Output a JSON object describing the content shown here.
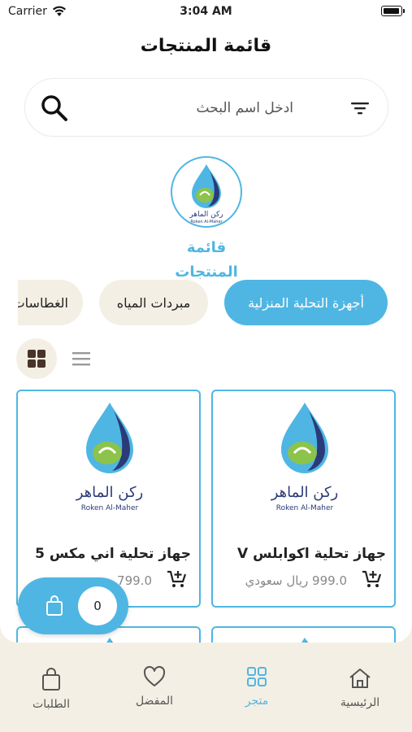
{
  "status_bar": {
    "carrier": "Carrier",
    "time": "3:04 AM"
  },
  "header": {
    "title": "قائمة المنتجات"
  },
  "search": {
    "placeholder": "ادخل اسم البحث",
    "value": ""
  },
  "brand": {
    "logo_text_ar": "ركن الماهر",
    "logo_text_en": "Roken Al-Maher",
    "caption": "قائمة المنتجات"
  },
  "categories": [
    {
      "label": "أجهزة التحلية المنزلية",
      "active": true
    },
    {
      "label": "مبردات المياه",
      "active": false
    },
    {
      "label": "الغطاسات",
      "active": false
    }
  ],
  "view_toggle": {
    "grid_icon": "grid-view-icon",
    "list_icon": "list-view-icon",
    "selected": "grid"
  },
  "products": [
    {
      "name": "جهاز تحلية اكوابلس V",
      "price": "999.0 ريال سعودي"
    },
    {
      "name": "جهاز تحلية اني مكس 5",
      "price": "799.0"
    }
  ],
  "cart": {
    "count": "0"
  },
  "bottom_nav": [
    {
      "label": "الرئيسية",
      "icon": "home-icon",
      "active": false
    },
    {
      "label": "متجر",
      "icon": "store-grid-icon",
      "active": true
    },
    {
      "label": "المفضل",
      "icon": "heart-icon",
      "active": false
    },
    {
      "label": "الطلبات",
      "icon": "bag-icon",
      "active": false
    }
  ],
  "colors": {
    "accent": "#4fb6e3",
    "beige": "#f4efe4",
    "logo_green": "#8cc34a",
    "logo_navy": "#2b3a78"
  }
}
